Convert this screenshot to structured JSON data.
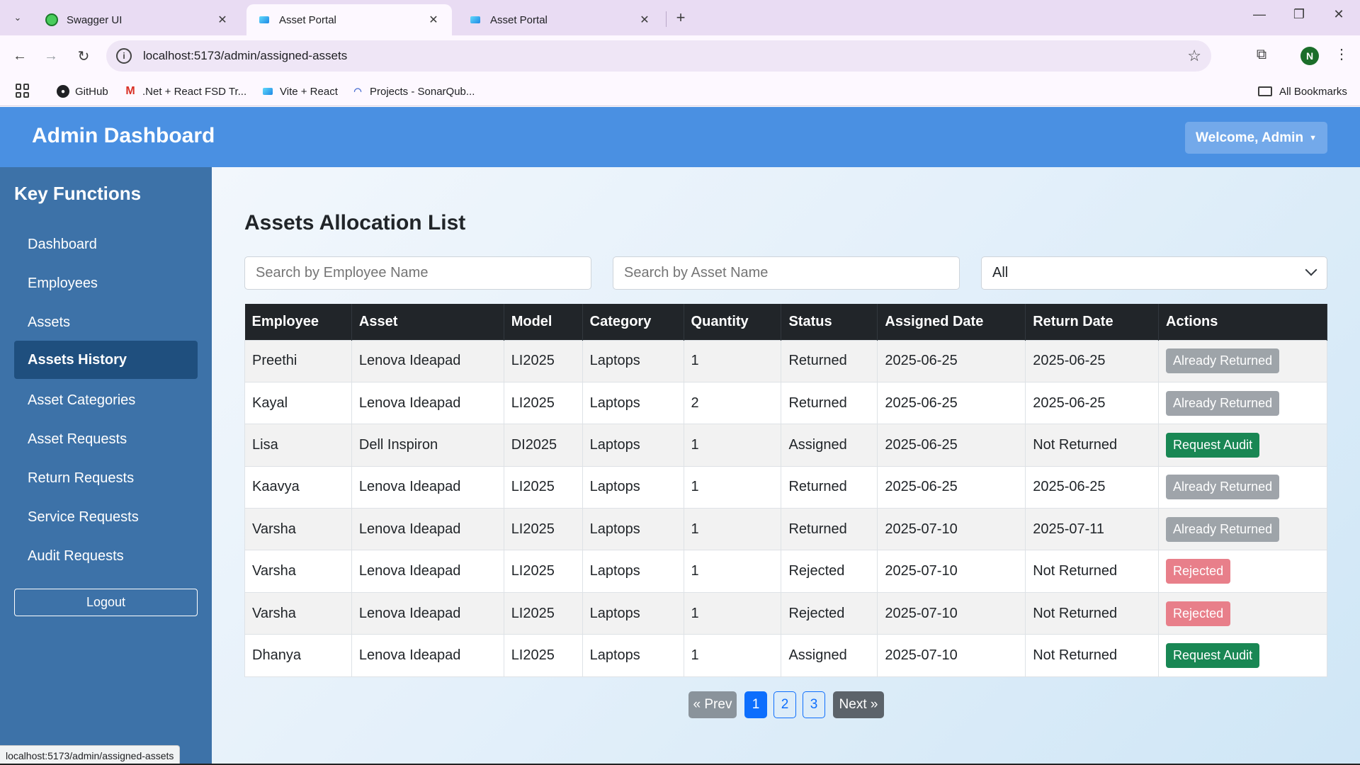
{
  "browser": {
    "tabs": [
      {
        "label": "Swagger UI",
        "icon": "swagger-icon"
      },
      {
        "label": "Asset Portal",
        "icon": "vite-icon"
      },
      {
        "label": "Asset Portal",
        "icon": "vite-icon"
      }
    ],
    "url": "localhost:5173/admin/assigned-assets",
    "profile_initial": "N",
    "bookmarks": [
      {
        "label": "GitHub",
        "icon": "github-icon"
      },
      {
        "label": ".Net + React FSD Tr...",
        "icon": "gmail-icon"
      },
      {
        "label": "Vite + React",
        "icon": "vite-icon"
      },
      {
        "label": "Projects - SonarQub...",
        "icon": "sonarqube-icon"
      }
    ],
    "all_bookmarks": "All Bookmarks",
    "status_url": "localhost:5173/admin/assigned-assets"
  },
  "header": {
    "title": "Admin Dashboard",
    "welcome": "Welcome, Admin"
  },
  "sidebar": {
    "title": "Key Functions",
    "items": [
      {
        "label": "Dashboard"
      },
      {
        "label": "Employees"
      },
      {
        "label": "Assets"
      },
      {
        "label": "Assets History",
        "active": true
      },
      {
        "label": "Asset Categories"
      },
      {
        "label": "Asset Requests"
      },
      {
        "label": "Return Requests"
      },
      {
        "label": "Service Requests"
      },
      {
        "label": "Audit Requests"
      }
    ],
    "logout": "Logout"
  },
  "main": {
    "title": "Assets Allocation List",
    "search_employee_placeholder": "Search by Employee Name",
    "search_asset_placeholder": "Search by Asset Name",
    "status_filter": "All",
    "columns": [
      "Employee",
      "Asset",
      "Model",
      "Category",
      "Quantity",
      "Status",
      "Assigned Date",
      "Return Date",
      "Actions"
    ],
    "rows": [
      {
        "employee": "Preethi",
        "asset": "Lenova Ideapad",
        "model": "LI2025",
        "category": "Laptops",
        "quantity": "1",
        "status": "Returned",
        "assigned": "2025-06-25",
        "returned": "2025-06-25",
        "action": "Already Returned",
        "action_type": "returned"
      },
      {
        "employee": "Kayal",
        "asset": "Lenova Ideapad",
        "model": "LI2025",
        "category": "Laptops",
        "quantity": "2",
        "status": "Returned",
        "assigned": "2025-06-25",
        "returned": "2025-06-25",
        "action": "Already Returned",
        "action_type": "returned"
      },
      {
        "employee": "Lisa",
        "asset": "Dell Inspiron",
        "model": "DI2025",
        "category": "Laptops",
        "quantity": "1",
        "status": "Assigned",
        "assigned": "2025-06-25",
        "returned": "Not Returned",
        "action": "Request Audit",
        "action_type": "audit"
      },
      {
        "employee": "Kaavya",
        "asset": "Lenova Ideapad",
        "model": "LI2025",
        "category": "Laptops",
        "quantity": "1",
        "status": "Returned",
        "assigned": "2025-06-25",
        "returned": "2025-06-25",
        "action": "Already Returned",
        "action_type": "returned"
      },
      {
        "employee": "Varsha",
        "asset": "Lenova Ideapad",
        "model": "LI2025",
        "category": "Laptops",
        "quantity": "1",
        "status": "Returned",
        "assigned": "2025-07-10",
        "returned": "2025-07-11",
        "action": "Already Returned",
        "action_type": "returned"
      },
      {
        "employee": "Varsha",
        "asset": "Lenova Ideapad",
        "model": "LI2025",
        "category": "Laptops",
        "quantity": "1",
        "status": "Rejected",
        "assigned": "2025-07-10",
        "returned": "Not Returned",
        "action": "Rejected",
        "action_type": "rejected"
      },
      {
        "employee": "Varsha",
        "asset": "Lenova Ideapad",
        "model": "LI2025",
        "category": "Laptops",
        "quantity": "1",
        "status": "Rejected",
        "assigned": "2025-07-10",
        "returned": "Not Returned",
        "action": "Rejected",
        "action_type": "rejected"
      },
      {
        "employee": "Dhanya",
        "asset": "Lenova Ideapad",
        "model": "LI2025",
        "category": "Laptops",
        "quantity": "1",
        "status": "Assigned",
        "assigned": "2025-07-10",
        "returned": "Not Returned",
        "action": "Request Audit",
        "action_type": "audit"
      }
    ],
    "pagination": {
      "prev": "« Prev",
      "pages": [
        "1",
        "2",
        "3"
      ],
      "current": "1",
      "next": "Next »"
    }
  },
  "colors": {
    "header": "#4a90e2",
    "sidebar": "#3d72a8",
    "sidebar_active": "#1f4f7e",
    "audit_button": "#198754",
    "rejected_button": "#e87f8a",
    "returned_button": "#9aa0a6",
    "page_active": "#0d6efd"
  }
}
